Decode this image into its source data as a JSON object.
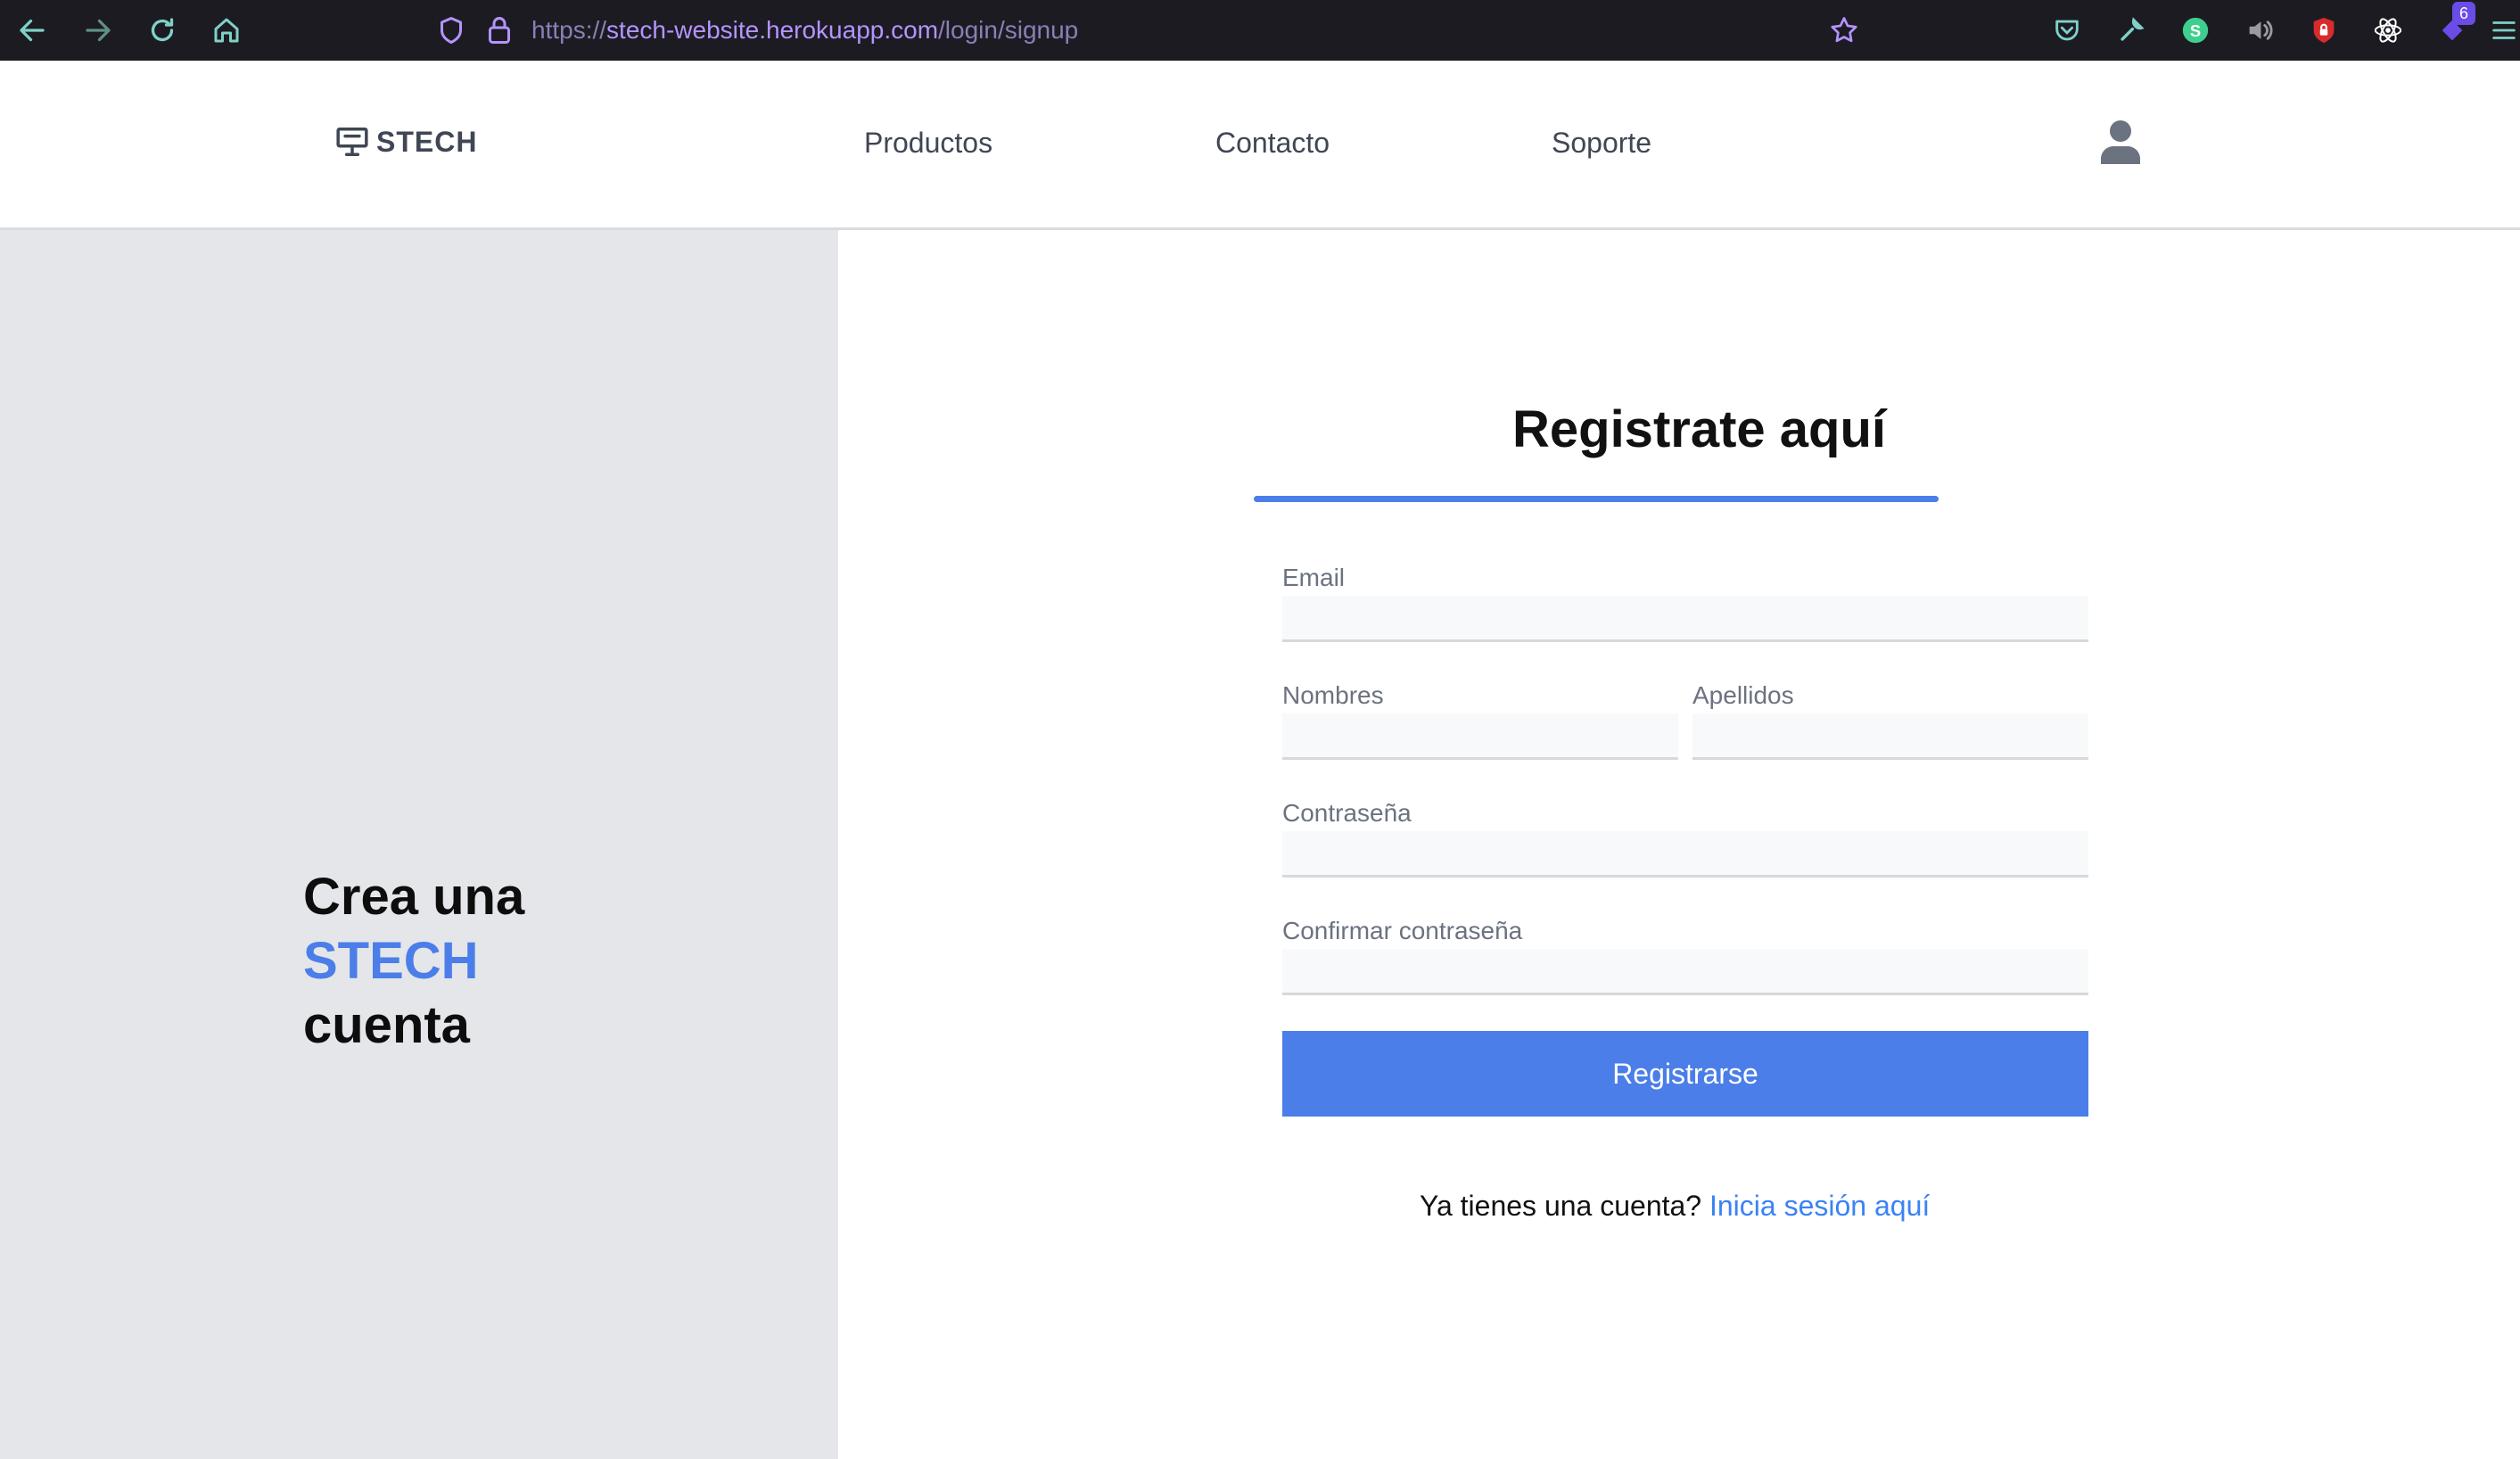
{
  "browser": {
    "url_scheme": "https://",
    "url_host": "stech-website.herokuapp.com",
    "url_path": "/login/signup",
    "extension_badge": "6",
    "icons": [
      "back-icon",
      "forward-icon",
      "reload-icon",
      "home-icon",
      "shield-icon",
      "lock-icon",
      "bookmark-star-icon",
      "pocket-icon",
      "wrench-icon",
      "s-extension-icon",
      "volume-icon",
      "ublock-icon",
      "react-devtools-icon",
      "extension-icon",
      "menu-icon"
    ]
  },
  "header": {
    "logo_text": "STECH",
    "nav": [
      {
        "label": "Productos"
      },
      {
        "label": "Contacto"
      },
      {
        "label": "Soporte"
      }
    ]
  },
  "left_panel": {
    "line1": "Crea una",
    "line2": "STECH",
    "line3": "cuenta"
  },
  "form": {
    "title": "Registrate aquí",
    "fields": {
      "email": {
        "label": "Email",
        "value": ""
      },
      "nombres": {
        "label": "Nombres",
        "value": ""
      },
      "apellidos": {
        "label": "Apellidos",
        "value": ""
      },
      "password": {
        "label": "Contraseña",
        "value": ""
      },
      "confirm": {
        "label": "Confirmar contraseña",
        "value": ""
      }
    },
    "submit_label": "Registrarse",
    "login_prompt": "Ya tienes una cuenta?",
    "login_link": "Inicia sesión aquí"
  },
  "colors": {
    "accent": "#4b7ee8",
    "link": "#3b82f6",
    "browser_bg": "#1c1b22",
    "left_panel_bg": "#e5e6e9"
  }
}
